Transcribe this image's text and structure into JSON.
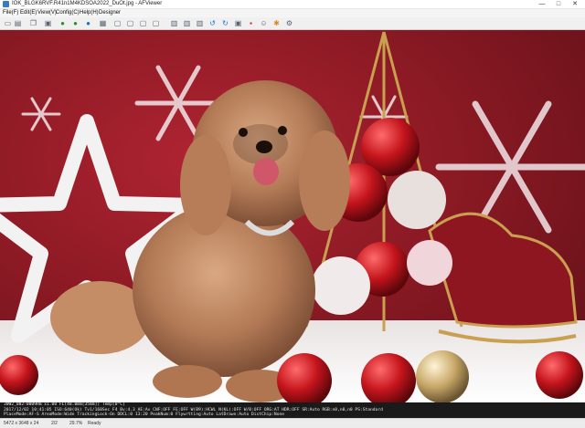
{
  "window": {
    "title": "IOK_BLGK6RVF.R41n1M4KDSOA2022_DuOt.jpg - AFViewer",
    "minimize": "—",
    "maximize": "□",
    "close": "✕"
  },
  "menu": [
    "File(F)",
    "Edit(E)",
    "View(V)",
    "Config(C)",
    "Help(H)",
    "Designer"
  ],
  "toolbar_icons": [
    "open-icon",
    "save-icon",
    "copy-icon",
    "paste-icon",
    "back-icon",
    "forward-icon",
    "reload-icon",
    "image-icon",
    "fit-icon",
    "zoom-in-icon",
    "zoom-out-icon",
    "actual-size-icon",
    "rotate-left-icon",
    "rotate-right-icon",
    "flip-icon",
    "crop-icon",
    "info-icon",
    "delete-icon",
    "print-icon",
    "run-icon",
    "star-icon",
    "settings-icon"
  ],
  "exif": {
    "line1": "30W2_002-0009Hm  x1.00  FL(48.0mm[35mm])  Temp[0°C]",
    "line2": "2017/12/02 10:41:05      ISO:640(Ok)      Tv1/160Sec  F4      Bv:4.3   AE:Av  CNF:OFF   FE:OFF   W(B9):HCWL N(KL):OFF  W/B:OFF  ORG:AT  HDR:OFF   SR:Auto  RGB:n0,n0,n0   PS:Standard",
    "line3": "PlaceMode:AF-S  AreaMode:Wide   TrackingLock-On   DDCL:0  13:20   PeakNum:0   Flywrtting:Auto   LatDrawn:Auto   DistChip:None"
  },
  "status": {
    "dimensions": "5472 x 3648 x 24",
    "index": "2/2",
    "zoom": "29.7%",
    "state": "Ready"
  }
}
